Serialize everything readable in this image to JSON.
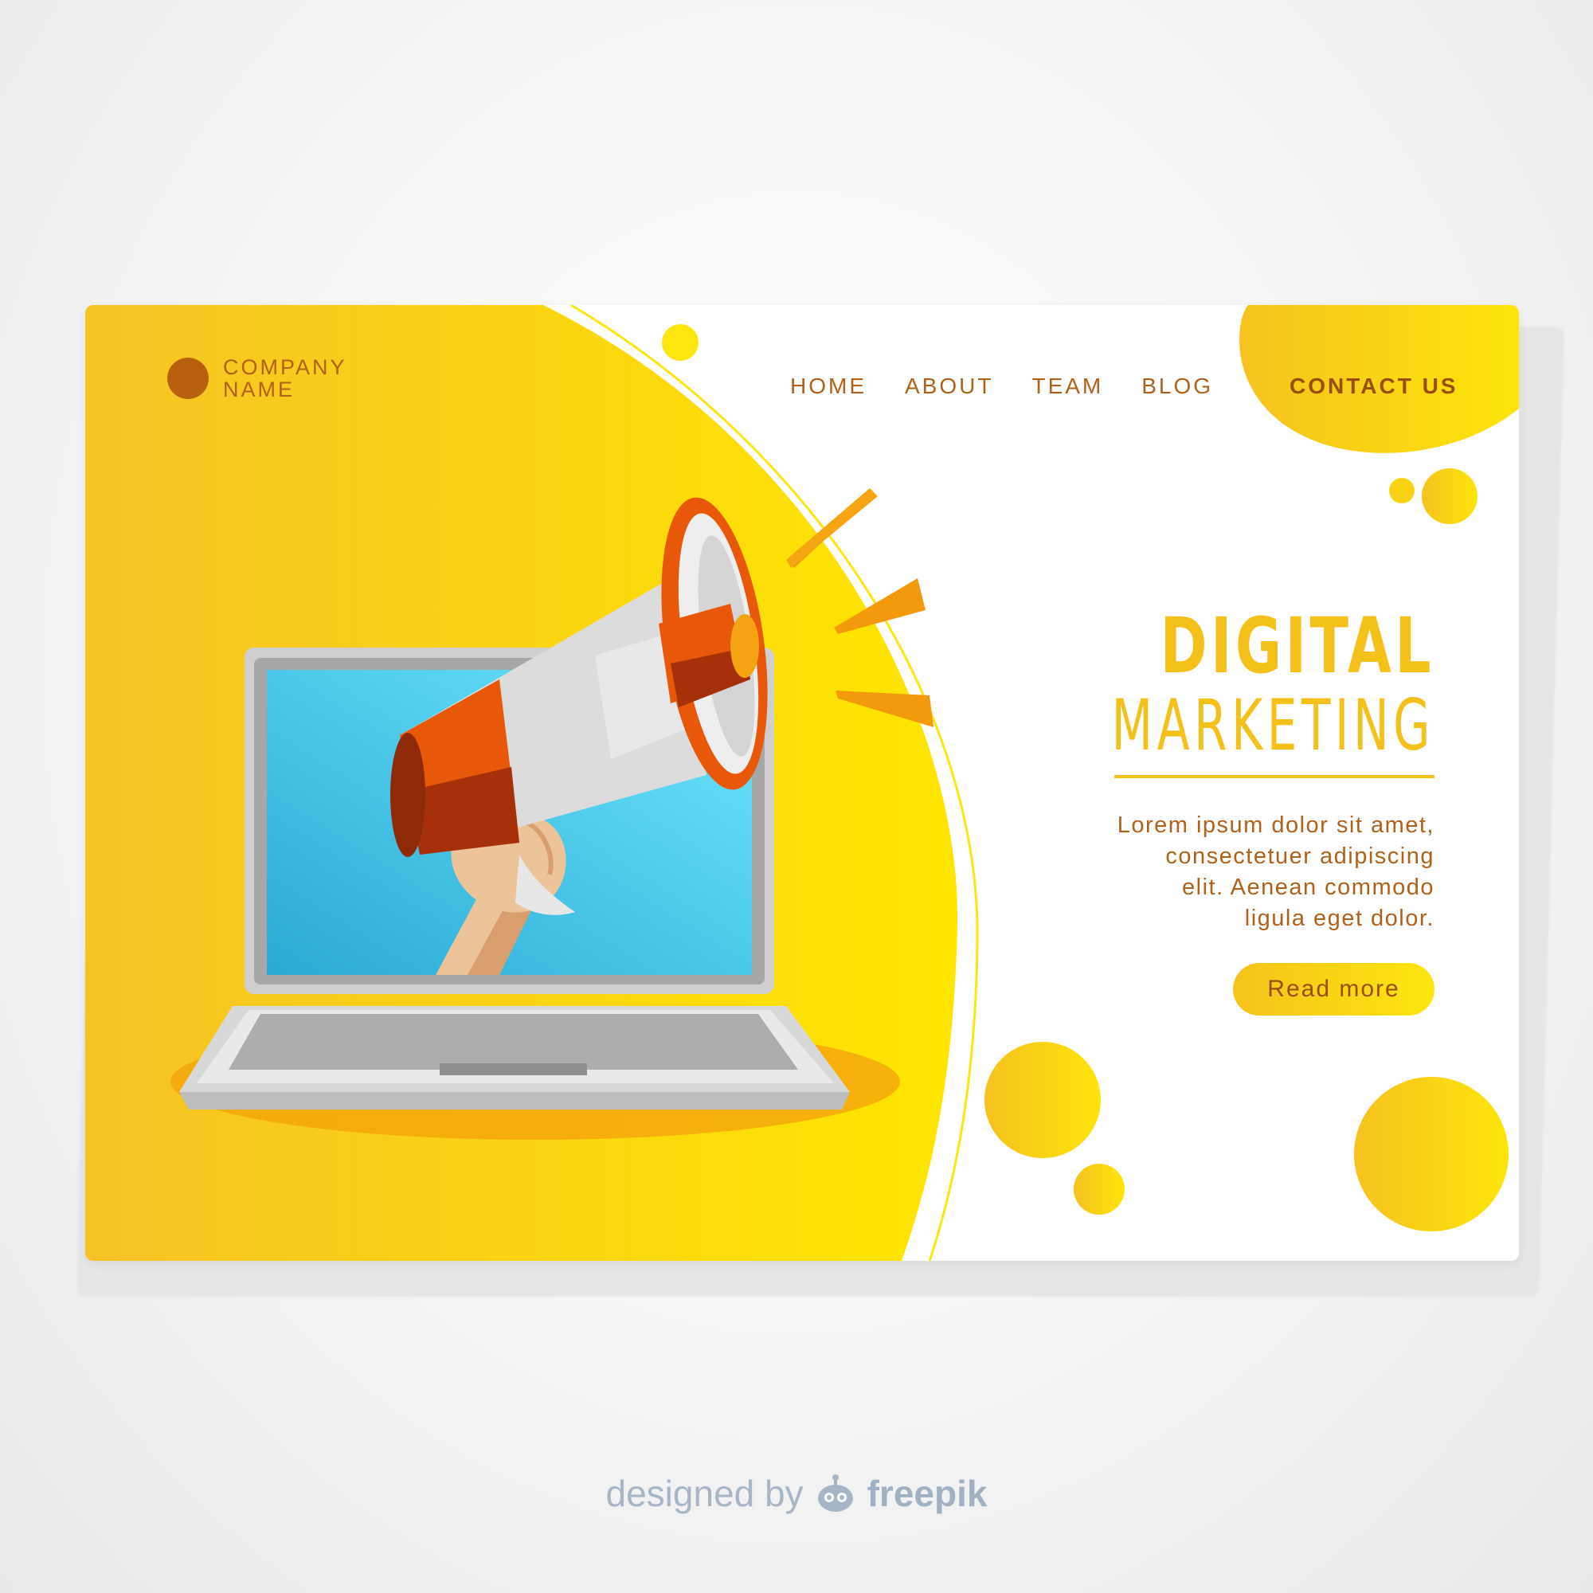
{
  "header": {
    "company_line_1": "COMPANY",
    "company_line_2": "NAME",
    "nav": [
      "HOME",
      "ABOUT",
      "TEAM",
      "BLOG"
    ],
    "contact": "CONTACT US"
  },
  "hero": {
    "title_1": "DIGITAL",
    "title_2": "MARKETING",
    "body_lines": [
      "Lorem ipsum dolor sit amet,",
      "consectetuer adipiscing",
      "elit. Aenean commodo",
      "ligula eget dolor."
    ],
    "cta": "Read more"
  },
  "credit": {
    "prefix": "designed by",
    "brand": "freepik"
  },
  "icons": {
    "logo": "circle-logo-icon",
    "illustration": "megaphone-laptop-icon",
    "credit": "robot-face-icon"
  },
  "colors": {
    "yellow": "#fde60e",
    "gold": "#f4c01a",
    "brown": "#b0611a",
    "orange": "#e85a0c"
  }
}
